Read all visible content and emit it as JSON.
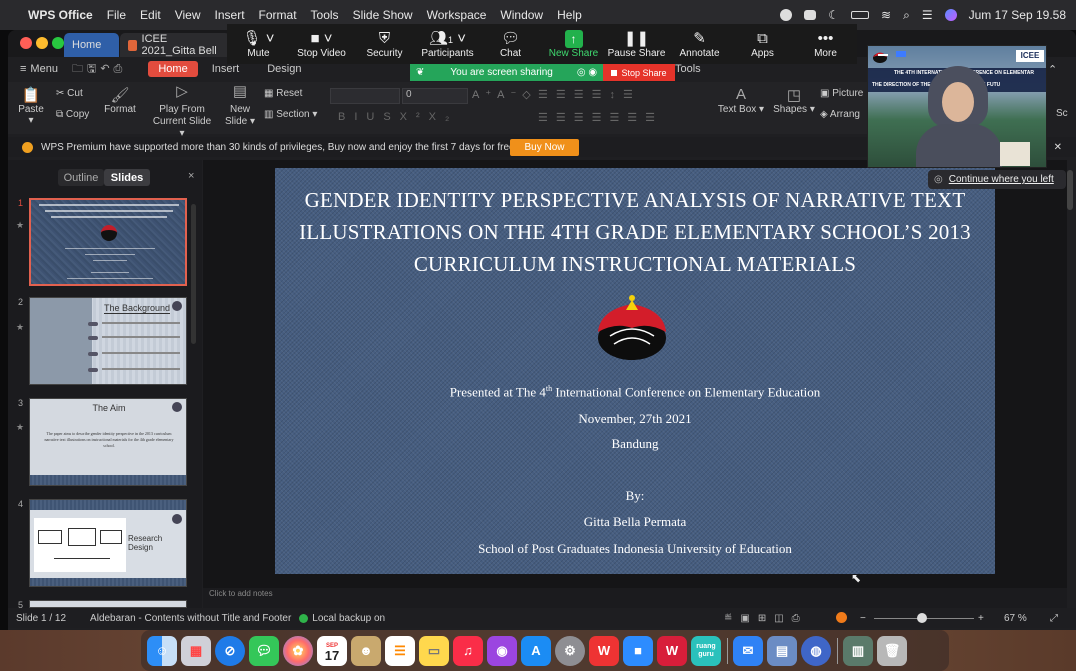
{
  "menubar": {
    "app": "WPS Office",
    "items": [
      "File",
      "Edit",
      "View",
      "Insert",
      "Format",
      "Tools",
      "Slide Show",
      "Workspace",
      "Window",
      "Help"
    ],
    "datetime": "Jum 17 Sep  19.58"
  },
  "window": {
    "tab_home": "Home",
    "doc_tab": "ICEE 2021_Gitta Bell"
  },
  "zoom_toolbar": {
    "mute": "Mute",
    "stop_video": "Stop Video",
    "security": "Security",
    "participants": "Participants",
    "participants_count": "1",
    "chat": "Chat",
    "new_share": "New Share",
    "pause_share": "Pause Share",
    "annotate": "Annotate",
    "apps": "Apps",
    "more": "More",
    "sharing_text": "You are screen sharing",
    "stop_share": "Stop Share"
  },
  "ribbon": {
    "menu": "Menu",
    "tabs": [
      "Home",
      "Insert",
      "Design",
      "Tools"
    ],
    "paste": "Paste",
    "cut": "Cut",
    "copy": "Copy",
    "format": "Format",
    "play_from_line1": "Play From",
    "play_from_line2": "Current Slide",
    "new_slide_line1": "New",
    "new_slide_line2": "Slide",
    "reset": "Reset",
    "section": "Section",
    "font_size": "0",
    "text_box": "Text Box",
    "shapes": "Shapes",
    "picture": "Picture",
    "arrange": "Arrang",
    "sc": "Sc"
  },
  "premium": {
    "text": "WPS Premium have supported more than 30 kinds of privileges, Buy now and enjoy the first 7 days for free!",
    "button": "Buy Now"
  },
  "left_panel": {
    "tab_outline": "Outline",
    "tab_slides": "Slides",
    "slide_numbers": [
      "1",
      "2",
      "3",
      "4",
      "5"
    ],
    "thumb2_title": "The Background",
    "thumb3_title": "The Aim",
    "thumb3_body": "The paper aims to describe gender identity perspective in the 2013 curriculum narrative text illustrations on instructional materials for the 4th grade elementary school.",
    "thumb4_title": "Research Design"
  },
  "slide": {
    "title": "GENDER IDENTITY PERSPECTIVE ANALYSIS OF NARRATIVE TEXT ILLUSTRATIONS ON THE 4TH GRADE ELEMENTARY SCHOOL’S 2013 CURRICULUM INSTRUCTIONAL MATERIALS",
    "presented_pre": "Presented at The 4",
    "presented_sup": "th",
    "presented_post": " International Conference on Elementary Education",
    "date": "November, 27th 2021",
    "city": "Bandung",
    "by": "By:",
    "author": "Gitta Bella Permata",
    "affiliation": "School of Post Graduates Indonesia University of Education"
  },
  "notes_placeholder": "Click to add notes",
  "statusbar": {
    "slide_counter": "Slide 1 / 12",
    "theme": "Aldebaran - Contents without Title and Footer",
    "backup": "Local backup on",
    "zoom": "67 %",
    "zoom_level": 0.67
  },
  "video": {
    "banner_line1": "THE 4TH INTERNATIONAL CONFERENCE ON ELEMENTARY",
    "banner_line2": "THE DIRECTION OF THE … EDUCATION IN THE FUTU",
    "badge": "ICEE"
  },
  "continue_label": "Continue where you left",
  "dock_calendar": {
    "month": "SEP",
    "day": "17"
  },
  "dock_ruang": "ruang guru",
  "colors": {
    "accent_orange": "#f0901a",
    "share_green": "#25a55a",
    "stop_red": "#e5332a",
    "slide_denim": "#465d80"
  }
}
